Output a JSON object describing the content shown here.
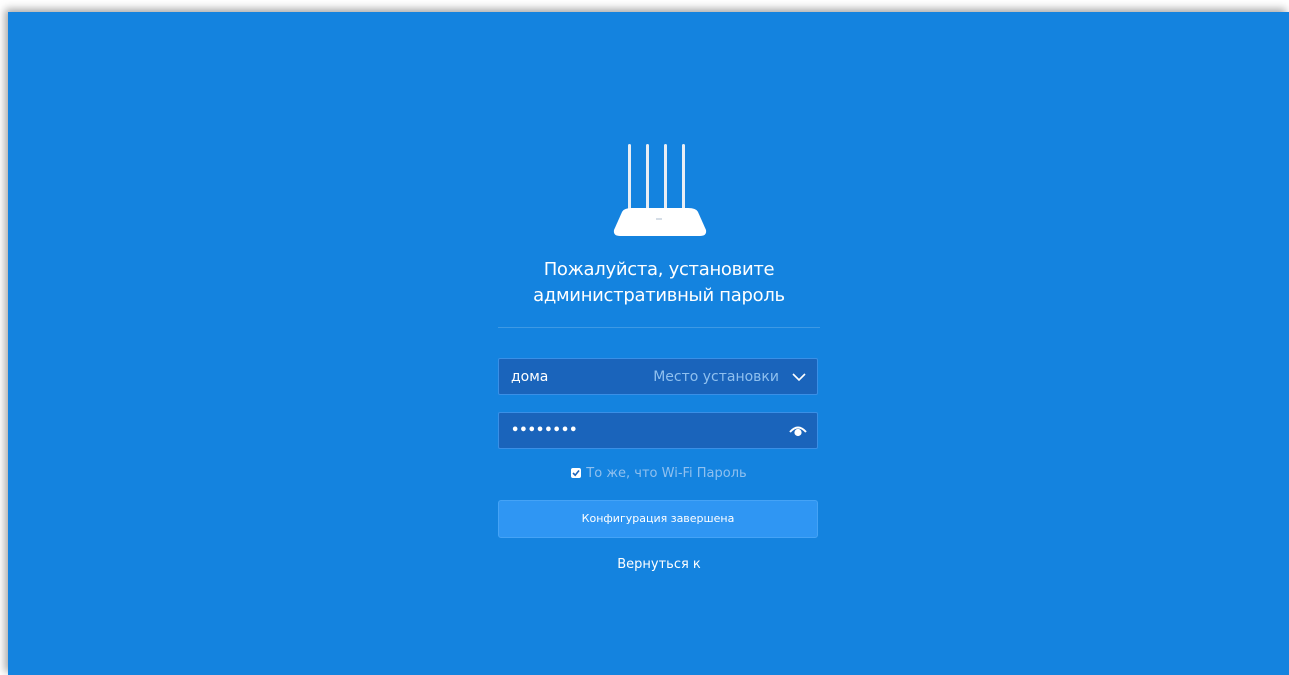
{
  "setup": {
    "title_line1": "Пожалуйста, установите",
    "title_line2": "административный пароль",
    "location": {
      "value": "дома",
      "placeholder": "Место установки"
    },
    "password": {
      "masked_value": "••••••••"
    },
    "same_as_wifi": {
      "label": "То же, что Wi-Fi Пароль",
      "checked": true
    },
    "submit_label": "Конфигурация завершена",
    "back_label": "Вернуться к"
  },
  "icons": {
    "router": "router-icon",
    "dropdown": "chevron-down-icon",
    "show_password": "eye-icon",
    "checkbox": "checkbox-checked-icon"
  },
  "colors": {
    "background": "#1483df",
    "field_background": "#1a64bb",
    "button": "#2f96f3"
  }
}
